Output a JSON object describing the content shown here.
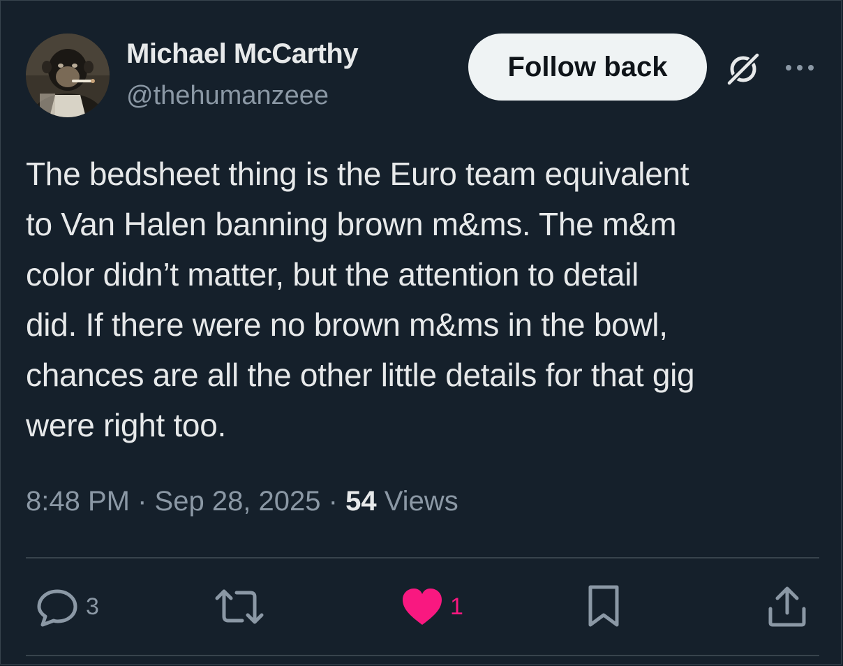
{
  "author": {
    "name": "Michael McCarthy",
    "handle": "@thehumanzeee"
  },
  "header": {
    "follow_label": "Follow back"
  },
  "post": {
    "text": "The bedsheet thing is the Euro team equivalent\nto Van Halen banning brown m&ms. The m&m\ncolor didn’t matter, but the attention to detail\ndid. If there were no brown m&ms in the bowl,\nchances are all the other little details for that gig\nwere right too.",
    "time": "8:48 PM",
    "date": "Sep 28, 2025",
    "views_count": "54",
    "views_label": "Views"
  },
  "actions": {
    "replies": "3",
    "likes": "1"
  },
  "colors": {
    "background": "#15202b",
    "primary_text": "#e7e9ea",
    "secondary_text": "#8b98a5",
    "like": "#f91880",
    "border": "#38444d"
  },
  "icons": [
    "grok-icon",
    "more-icon",
    "reply-icon",
    "retweet-icon",
    "heart-icon",
    "bookmark-icon",
    "share-icon"
  ]
}
